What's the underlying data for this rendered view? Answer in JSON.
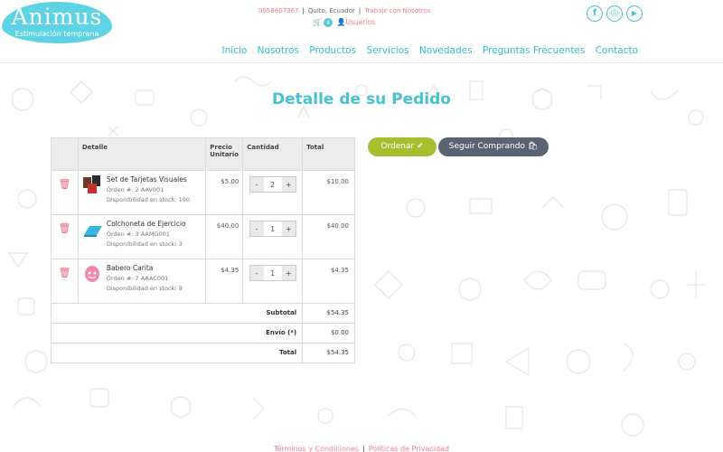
{
  "brand": {
    "name": "Animus",
    "tagline": "Estimulación temprana"
  },
  "topbar": {
    "phone": "0958607367",
    "city": "Quito, Ecuador",
    "jobs_link": "Trabaje con Nosotros",
    "cart_count": "4",
    "users_link": "Usuarios"
  },
  "social": [
    {
      "icon": "facebook-icon",
      "glyph": "f"
    },
    {
      "icon": "instagram-icon",
      "glyph": "◎"
    },
    {
      "icon": "youtube-icon",
      "glyph": "▶"
    }
  ],
  "nav": [
    "Inicio",
    "Nosotros",
    "Productos",
    "Servicios",
    "Novedades",
    "Preguntas Frecuentes",
    "Contacto"
  ],
  "page_title": "Detalle de su Pedido",
  "table": {
    "headers": {
      "detail": "Detalle",
      "unit_price": "Precio Unitario",
      "quantity": "Cantidad",
      "total": "Total"
    },
    "items": [
      {
        "name": "Set de Tarjetas Visuales",
        "order": "Órden #: 2 AAV001",
        "stock": "Disponibilidad en stock: 100",
        "price": "$5.00",
        "qty": "2",
        "total": "$10.00"
      },
      {
        "name": "Colchoneta de Ejercicio",
        "order": "Órden #: 3 AAMG001",
        "stock": "Disponibilidad en stock: 3",
        "price": "$40.00",
        "qty": "1",
        "total": "$40.00"
      },
      {
        "name": "Babero Carita",
        "order": "Órden #: 7 AAAC001",
        "stock": "Disponibilidad en stock: 9",
        "price": "$4.35",
        "qty": "1",
        "total": "$4.35"
      }
    ],
    "stepper": {
      "minus": "-",
      "plus": "+"
    },
    "summary": {
      "subtotal_label": "Subtotal",
      "subtotal": "$54.35",
      "shipping_label": "Envío (*)",
      "shipping": "$0.00",
      "total_label": "Total",
      "total": "$54.35"
    }
  },
  "actions": {
    "order": "Ordenar ✔",
    "continue": "Seguir Comprando 🛍"
  },
  "footer": {
    "terms": "Términos y Condiciones",
    "privacy": "Políticas de Privacidad"
  },
  "colors": {
    "brand_cyan": "#47c2d3",
    "pink": "#f07c8a",
    "order_green": "#a7bf2f",
    "continue_gray": "#5a6470"
  }
}
